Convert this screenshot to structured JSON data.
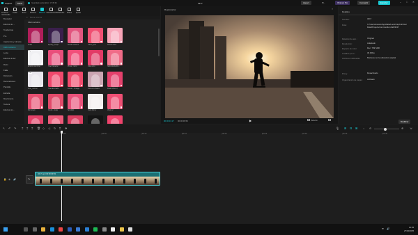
{
  "app": {
    "name": "CapCut",
    "menu_label": "Menú",
    "autosave": "Guardado automático: 17:45:34",
    "project_title": "3217",
    "layout_btn": "Aspect",
    "pro_btn": "Pr...",
    "upgrade_btn": "Obtener Pro",
    "share_btn": "Compartir",
    "export_btn": "Exportar"
  },
  "toolbar": {
    "tabs": [
      {
        "label": "Archivos multimedia",
        "icon": "media-icon"
      },
      {
        "label": "Audio",
        "icon": "audio-icon"
      },
      {
        "label": "Texto",
        "icon": "text-icon"
      },
      {
        "label": "Stickers",
        "icon": "sticker-icon"
      },
      {
        "label": "Efectos",
        "icon": "effects-icon"
      },
      {
        "label": "Transiciones",
        "icon": "transition-icon"
      },
      {
        "label": "Subtítulos",
        "icon": "subtitle-icon"
      },
      {
        "label": "Filtros",
        "icon": "filter-icon"
      },
      {
        "label": "Ajuste",
        "icon": "adjust-icon"
      }
    ],
    "active": 4
  },
  "sidebar": {
    "items": [
      "Buscador",
      "Efectos de ...",
      "Tendencias",
      "Pro",
      "Apariencia y cámara",
      "Club nocturno",
      "Lente",
      "Efectos de luz",
      "Retro",
      "Falla",
      "Distorsión",
      "Decoraciones",
      "Pantalla",
      "Estrella",
      "Movimiento",
      "Textura",
      "Efectos sin..."
    ],
    "selected": 5
  },
  "effects": {
    "search_placeholder": "Buscar efectos",
    "section_title": "Club nocturno",
    "items": [
      "Vidas",
      "Spooky_neopx",
      "Sonido estéreo",
      "Colour_ortn",
      "Sonido Soul",
      "Entorno de ritmo",
      "Pixel moveme",
      "Photo - retro",
      "Brillo retro",
      "Sinfonía de dis...",
      "Frito_normal",
      "Pixel alternado",
      "Fondo - Vintage",
      "Bordes retinales",
      "Flash Mirror 2",
      "Mirrorsam",
      "Dísdio - vidas",
      "Spotlight",
      "Flash Mirror",
      "Visión 2",
      "Montonoima 8",
      "Fuego 3",
      "Vintage",
      "Disparo",
      "Dolor de estreno",
      "",
      "",
      "",
      "",
      ""
    ],
    "pro_indices": [
      5,
      10,
      25,
      28
    ],
    "tints": [
      "#b01e5a",
      "#3a1f4c",
      "#e2557f",
      "#f04f72",
      "#f8a5b8",
      "#f0f0f3",
      "#e94e7b",
      "#f24f7a",
      "#e23a66",
      "#f06c88",
      "#e9e6ec",
      "#f0496d",
      "#f04a6c",
      "#caa4b1",
      "#e5406c",
      "#e64f70",
      "#e24a6a",
      "#e9517a",
      "#f3efef",
      "#ee4f74",
      "#e24168",
      "#ee5a7a",
      "#db3e61",
      "#141414",
      "#f0436c",
      "#ef5075",
      "#e8457a",
      "#f5eef2",
      "#f04b70",
      "#f04b70"
    ]
  },
  "player": {
    "title": "Reproductor",
    "current_time": "00:00:01:17",
    "total_time": "00:00:09:53",
    "ratio": "Relación",
    "fit": "Ajustar"
  },
  "details": {
    "title": "Detalles",
    "rows": [
      {
        "label": "Nombre:",
        "value": "3217"
      },
      {
        "label": "Ruta:",
        "value": "C:/Users/usuario/AppData/Local/CapCut/User Data/Projects/com.lveditor.draft/3217"
      },
      {
        "label": "Relación de asp.:",
        "value": "Original"
      },
      {
        "label": "Resolución:",
        "value": "Adaptado"
      },
      {
        "label": "Espacio de color:",
        "value": "Rec. 709 SDR"
      },
      {
        "label": "Cuadros por s.:",
        "value": "30.00fps"
      },
      {
        "label": "Archivos multimedia:",
        "value": "Mantener en la ubicación original"
      },
      {
        "label": "Proxy:",
        "value": "Desactivado"
      },
      {
        "label": "Organización de capas:",
        "value": "Activado"
      }
    ],
    "modify_btn": "Modificar"
  },
  "timeline": {
    "ruler": [
      "00:00",
      "|00:05",
      "|00:10",
      "|00:15",
      "|00:20",
      "|00:25",
      "|00:30",
      "|00:35",
      "|00:40",
      "|00:45"
    ],
    "clip_label": "3217.mp4   00:00:09:53",
    "cover_label": "Portada"
  },
  "taskbar": {
    "time": "12:45",
    "date": "27/02/2025"
  },
  "colors": {
    "accent": "#19c8d2",
    "clip": "#1a6f73",
    "export": "#19c8d2"
  }
}
